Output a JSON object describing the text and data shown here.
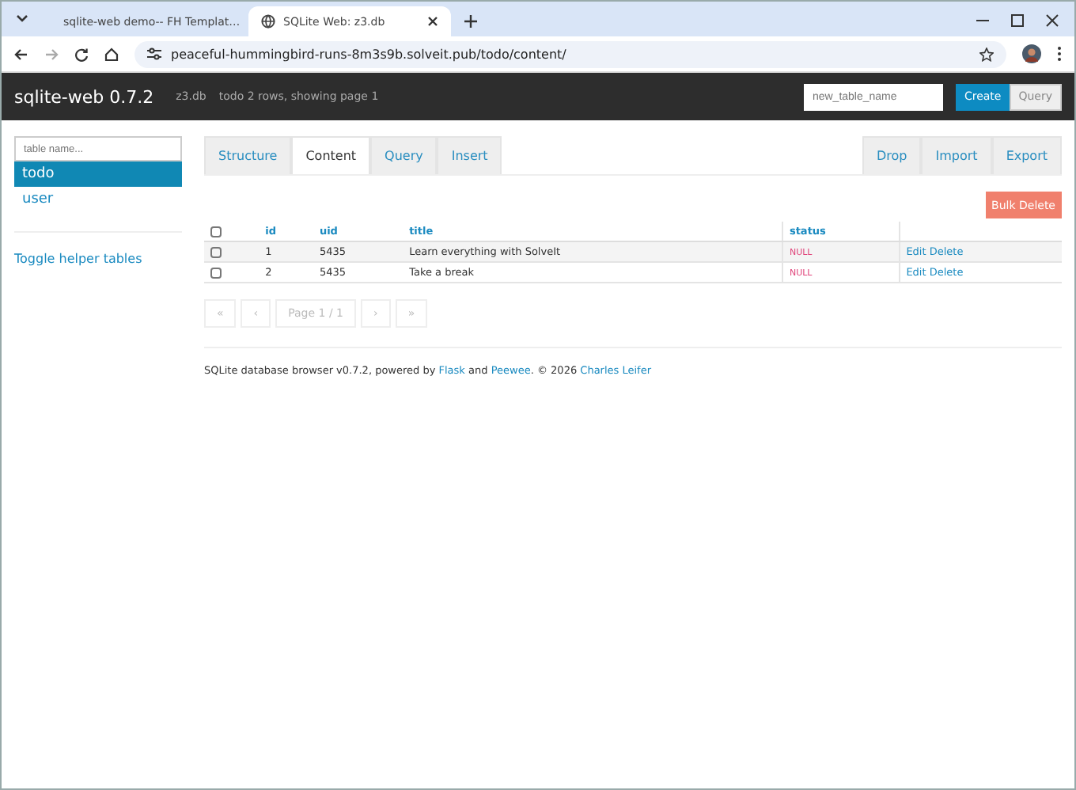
{
  "browser": {
    "tabs": [
      {
        "title": "sqlite-web demo-- FH Templat…",
        "selected": false
      },
      {
        "title": "SQLite Web: z3.db",
        "selected": true
      }
    ],
    "url": "peaceful-hummingbird-runs-8m3s9b.solveit.pub/todo/content/"
  },
  "header": {
    "brand": "sqlite-web 0.7.2",
    "db": "z3.db",
    "summary": "todo 2 rows, showing page 1",
    "new_table_placeholder": "new_table_name",
    "buttons": [
      "Create",
      "Query"
    ]
  },
  "sidebar": {
    "search_placeholder": "table name...",
    "tables": [
      {
        "name": "todo",
        "selected": true
      },
      {
        "name": "user",
        "selected": false
      }
    ],
    "toggle": "Toggle helper tables"
  },
  "tabs": [
    {
      "label": "Structure",
      "selected": false
    },
    {
      "label": "Content",
      "selected": true
    },
    {
      "label": "Query",
      "selected": false
    },
    {
      "label": "Insert",
      "selected": false
    }
  ],
  "actions": [
    "Drop",
    "Import",
    "Export"
  ],
  "bulk_delete": "Bulk Delete",
  "table": {
    "select_all_checked": false,
    "columns": [
      "id",
      "uid",
      "title",
      "status"
    ],
    "rows": [
      {
        "checked": false,
        "cells": [
          "1",
          "5435",
          "Learn everything with SolveIt",
          "NULL"
        ],
        "links": [
          "Edit",
          "Delete"
        ]
      },
      {
        "checked": false,
        "cells": [
          "2",
          "5435",
          "Take a break",
          "NULL"
        ],
        "links": [
          "Edit",
          "Delete"
        ]
      }
    ]
  },
  "pager": [
    "«",
    "‹",
    "Page 1 / 1",
    "›",
    "»"
  ],
  "footer": [
    {
      "kind": "text",
      "text": "SQLite database browser v0.7.2, powered by "
    },
    {
      "kind": "link",
      "text": "Flask"
    },
    {
      "kind": "text",
      "text": " and "
    },
    {
      "kind": "link",
      "text": "Peewee"
    },
    {
      "kind": "text",
      "text": ". © 2026 "
    },
    {
      "kind": "link",
      "text": "Charles Leifer"
    }
  ]
}
